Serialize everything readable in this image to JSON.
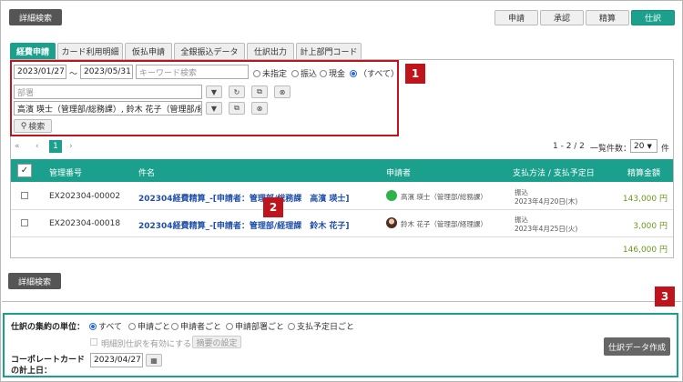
{
  "top": {
    "detail_search": "詳細検索",
    "tabs_right": [
      "申請",
      "承認",
      "精算",
      "仕訳"
    ]
  },
  "tabs": [
    "経費申請",
    "カード利用明細",
    "仮払申請",
    "全銀振込データ",
    "仕訳出力",
    "計上部門コード"
  ],
  "search": {
    "date_from": "2023/01/27",
    "tilde": "〜",
    "date_to": "2023/05/31",
    "keyword_placeholder": "キーワード検索",
    "radios": [
      "未指定",
      "振込",
      "現金",
      "（すべて）"
    ],
    "department_placeholder": "部署",
    "applicants": "高濱 瑛士（管理部/総務課）, 鈴木 花子（管理部/経理課）",
    "search_button": "検索"
  },
  "badges": {
    "one": "1",
    "two": "2",
    "three": "3"
  },
  "pagination": {
    "first": "«",
    "prev": "‹",
    "page": "1",
    "next": "›",
    "range": "1 - 2 / 2",
    "per_page_label": "一覧件数：",
    "per_page": "20",
    "unit": "件"
  },
  "table": {
    "headers": {
      "id": "管理番号",
      "name": "件名",
      "applicant": "申請者",
      "payment": "支払方法 / 支払予定日",
      "amount": "精算金額"
    },
    "rows": [
      {
        "id": "EX202304-00002",
        "name": "202304経費精算_-[申請者：管理部/総務課　高濱 瑛士]",
        "applicant": "高濱 瑛士（管理部/総務課）",
        "method": "振込",
        "date": "2023年4月20日(木)",
        "amount": "143,000 円"
      },
      {
        "id": "EX202304-00018",
        "name": "202304経費精算_-[申請者：管理部/経理課　鈴木 花子]",
        "applicant": "鈴木 花子（管理部/経理課）",
        "method": "振込",
        "date": "2023年4月25日(火)",
        "amount": "3,000 円"
      }
    ],
    "total": "146,000 円"
  },
  "bottom": {
    "detail_search": "詳細検索",
    "unit_label": "仕訳の集約の単位：",
    "unit_options": [
      "すべて",
      "申請ごと",
      "申請者ごと",
      "申請部署ごと",
      "支払予定日ごと"
    ],
    "detail_checkbox": "明細別仕訳を有効にする",
    "summary_button": "摘要の設定",
    "card_label_1": "コーポレートカード",
    "card_label_2": "の計上日：",
    "card_date": "2023/04/27",
    "create_button": "仕訳データ作成"
  },
  "colors": {
    "accent": "#1aa08c",
    "highlight": "#c0141c"
  }
}
